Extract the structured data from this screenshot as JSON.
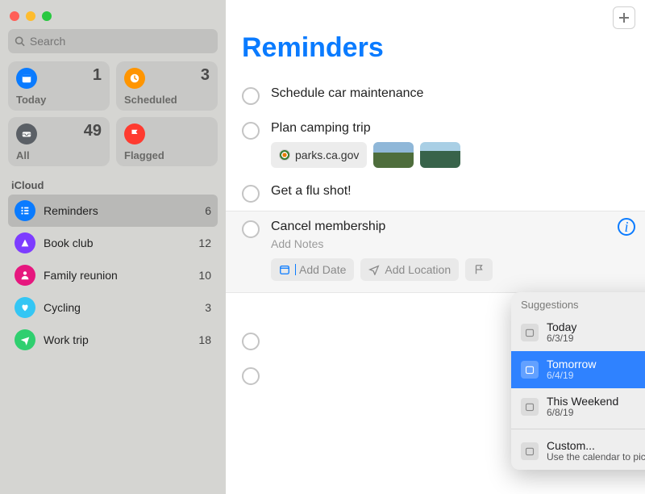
{
  "colors": {
    "accent": "#0a7bff",
    "today": "#0a7bff",
    "scheduled": "#ff9500",
    "all": "#5b6066",
    "flagged": "#ff3b30",
    "reminders": "#0a7bff",
    "bookclub": "#7d3cff",
    "family": "#e6177e",
    "cycling": "#34c6f4",
    "worktrip": "#2fcf6f"
  },
  "search": {
    "placeholder": "Search"
  },
  "smart": {
    "today": {
      "label": "Today",
      "count": 1
    },
    "scheduled": {
      "label": "Scheduled",
      "count": 3
    },
    "all": {
      "label": "All",
      "count": 49
    },
    "flagged": {
      "label": "Flagged",
      "count": ""
    }
  },
  "section": "iCloud",
  "lists": [
    {
      "name": "Reminders",
      "count": 6,
      "color": "#0a7bff",
      "icon": "list",
      "selected": true
    },
    {
      "name": "Book club",
      "count": 12,
      "color": "#7d3cff",
      "icon": "tent",
      "selected": false
    },
    {
      "name": "Family reunion",
      "count": 10,
      "color": "#e6177e",
      "icon": "person",
      "selected": false
    },
    {
      "name": "Cycling",
      "count": 3,
      "color": "#34c6f4",
      "icon": "heart",
      "selected": false
    },
    {
      "name": "Work trip",
      "count": 18,
      "color": "#2fcf6f",
      "icon": "plane",
      "selected": false
    }
  ],
  "main": {
    "title": "Reminders",
    "tasks": [
      {
        "title": "Schedule car maintenance"
      },
      {
        "title": "Plan camping trip",
        "link": "parks.ca.gov",
        "thumbs": 2
      },
      {
        "title": "Get a flu shot!"
      }
    ],
    "editing": {
      "title": "Cancel membership",
      "notes_placeholder": "Add Notes",
      "add_date": "Add Date",
      "add_location": "Add Location"
    }
  },
  "suggestions": {
    "header": "Suggestions",
    "items": [
      {
        "label": "Today",
        "date": "6/3/19",
        "selected": false
      },
      {
        "label": "Tomorrow",
        "date": "6/4/19",
        "selected": true
      },
      {
        "label": "This Weekend",
        "date": "6/8/19",
        "selected": false
      }
    ],
    "custom": {
      "label": "Custom...",
      "hint": "Use the calendar to pick a date"
    }
  }
}
